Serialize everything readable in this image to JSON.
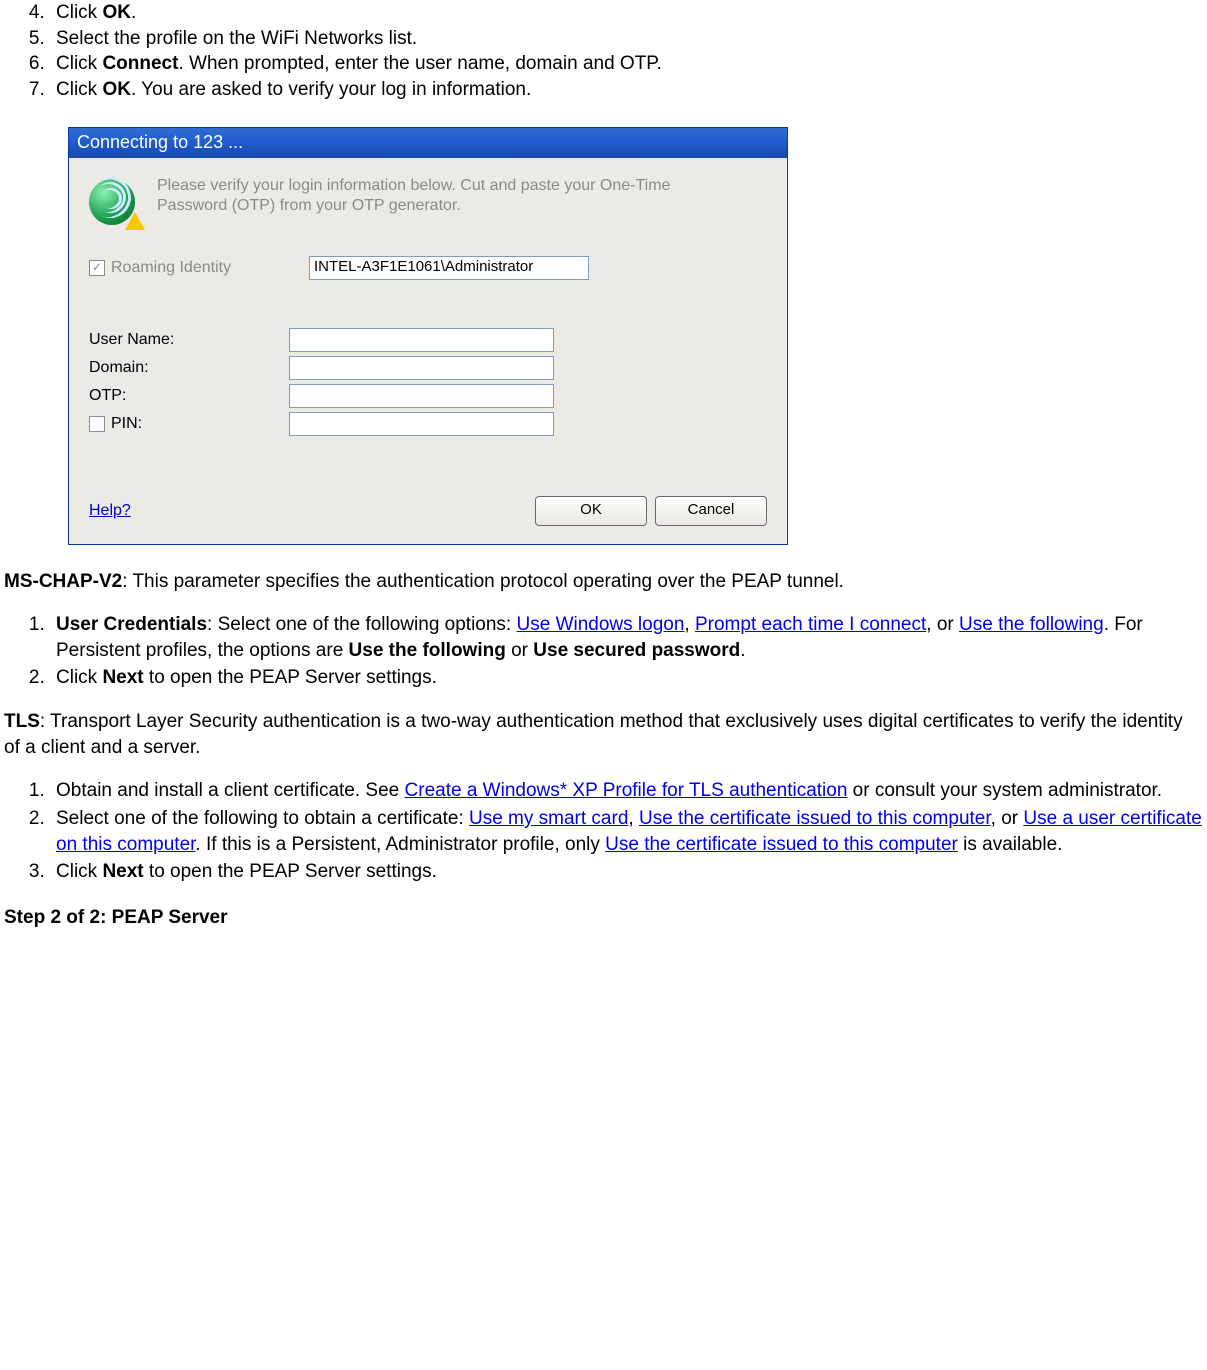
{
  "steps_top": [
    {
      "pre": "Click ",
      "bold": "OK",
      "post": "."
    },
    {
      "pre": "Select the profile on the WiFi Networks list."
    },
    {
      "pre": "Click ",
      "bold": "Connect",
      "post": ". When prompted, enter the user name, domain and OTP."
    },
    {
      "pre": "Click ",
      "bold": "OK",
      "post": ". You are asked to verify your log in information."
    }
  ],
  "dialog": {
    "title": "Connecting to 123 ...",
    "message": "Please verify your login information below. Cut and paste your One-Time Password (OTP) from your OTP generator.",
    "roaming_label": "Roaming Identity",
    "roaming_value": "INTEL-A3F1E1061\\Administrator",
    "rows": {
      "username": "User Name:",
      "domain": "Domain:",
      "otp": "OTP:",
      "pin": "PIN:"
    },
    "help": "Help?",
    "ok": "OK",
    "cancel": "Cancel"
  },
  "mschap": {
    "label": "MS-CHAP-V2",
    "text": ": This parameter specifies the authentication protocol operating over the PEAP tunnel.",
    "items": {
      "i1_b1": "User Credentials",
      "i1_t1": ": Select one of the following options: ",
      "i1_l1": "Use Windows logon",
      "i1_s1": ", ",
      "i1_l2": "Prompt each time I connect",
      "i1_s2": ", or ",
      "i1_l3": "Use the following",
      "i1_t2": ". For Persistent profiles, the options are ",
      "i1_b2": "Use the following",
      "i1_s3": " or ",
      "i1_b3": "Use secured password",
      "i1_s4": ".",
      "i2_t1": "Click ",
      "i2_b1": "Next",
      "i2_t2": " to open the PEAP Server settings."
    }
  },
  "tls": {
    "label": "TLS",
    "text": ": Transport Layer Security authentication is a two-way authentication method that exclusively uses digital certificates to verify the identity of a client and a server.",
    "items": {
      "i1_t1": "Obtain and install a client certificate. See ",
      "i1_l1": "Create a Windows* XP Profile for TLS authentication",
      "i1_t2": " or consult your system administrator.",
      "i2_t1": "Select one of the following to obtain a certificate: ",
      "i2_l1": "Use my smart card",
      "i2_s1": ", ",
      "i2_l2": "Use the certificate issued to this computer",
      "i2_s2": ", or ",
      "i2_l3": "Use a user certificate on this computer",
      "i2_t2": ". If this is a Persistent, Administrator profile, only ",
      "i2_l4": "Use the certificate issued to this computer",
      "i2_t3": " is available.",
      "i3_t1": "Click ",
      "i3_b1": "Next",
      "i3_t2": " to open the PEAP Server settings."
    }
  },
  "heading": "Step 2 of 2: PEAP Server"
}
